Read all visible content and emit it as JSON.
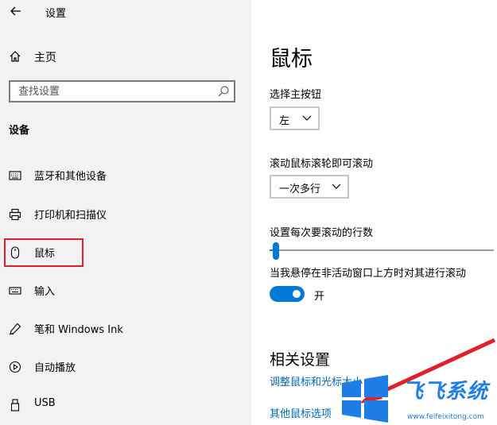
{
  "window": {
    "title": "设置"
  },
  "sidebar": {
    "home_label": "主页",
    "search_placeholder": "查找设置",
    "section_title": "设备",
    "items": [
      {
        "label": "蓝牙和其他设备",
        "icon": "keyboard-icon"
      },
      {
        "label": "打印机和扫描仪",
        "icon": "printer-icon"
      },
      {
        "label": "鼠标",
        "icon": "mouse-icon",
        "highlighted": true
      },
      {
        "label": "输入",
        "icon": "keyboard-icon"
      },
      {
        "label": "笔和 Windows Ink",
        "icon": "pen-icon"
      },
      {
        "label": "自动播放",
        "icon": "autoplay-icon"
      },
      {
        "label": "USB",
        "icon": "usb-icon"
      }
    ]
  },
  "main": {
    "page_title": "鼠标",
    "primary_button": {
      "label": "选择主按钮",
      "value": "左"
    },
    "wheel_scroll": {
      "label": "滚动鼠标滚轮即可滚动",
      "value": "一次多行"
    },
    "lines_to_scroll": {
      "label": "设置每次要滚动的行数",
      "value_fraction": 0.03
    },
    "inactive_scroll": {
      "label": "当我悬停在非活动窗口上方时对其进行滚动",
      "state_label": "开",
      "on": true
    },
    "related": {
      "title": "相关设置",
      "links": [
        "调整鼠标和光标大小",
        "其他鼠标选项"
      ]
    }
  },
  "watermark": {
    "brand": "飞飞系统",
    "url": "www.feifeixitong.com"
  },
  "colors": {
    "accent": "#0078d7",
    "link": "#0067b8",
    "highlight": "#e0202a",
    "sidebar_bg": "#f2f2f2"
  }
}
